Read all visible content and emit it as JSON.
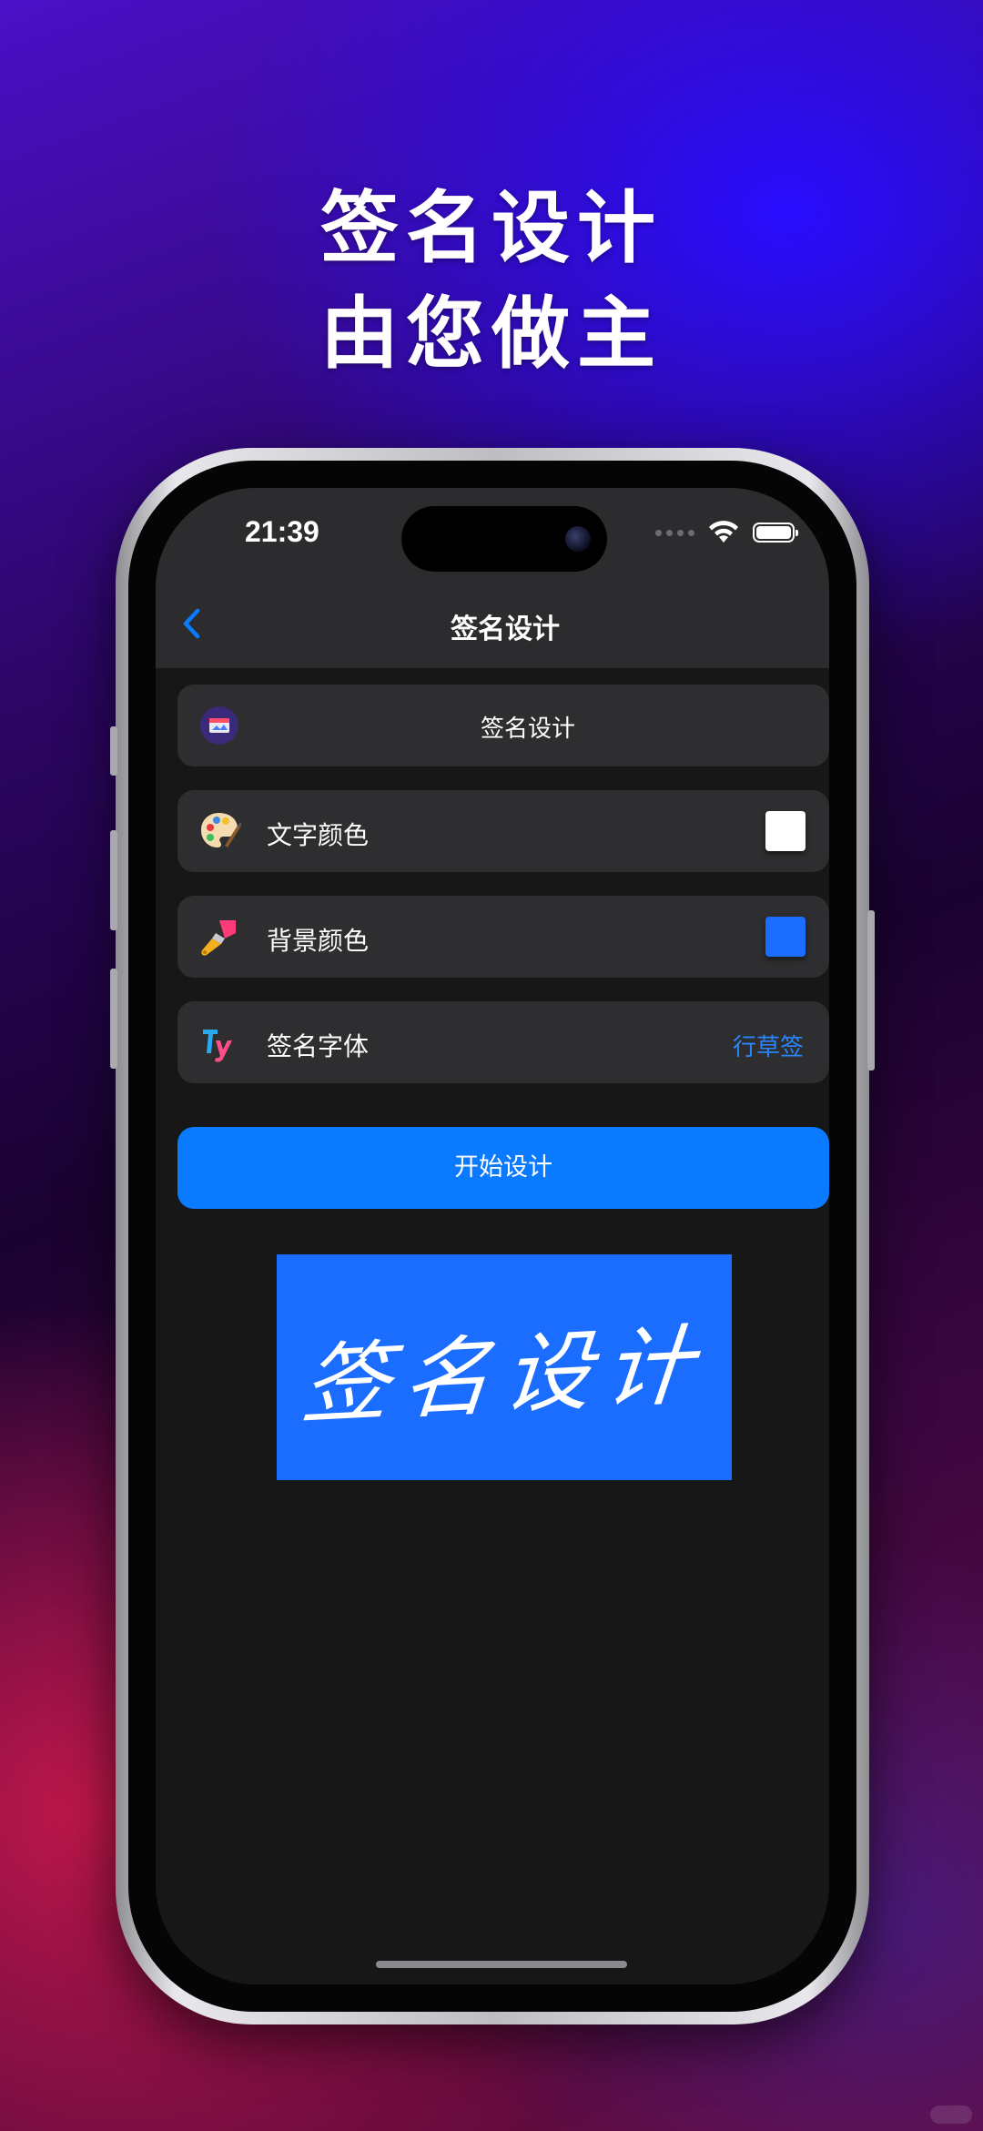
{
  "promo": {
    "line1": "签名设计",
    "line2": "由您做主"
  },
  "status_bar": {
    "time": "21:39",
    "wifi_icon": "wifi-icon",
    "battery_icon": "battery-icon"
  },
  "nav": {
    "back_icon": "chevron-left-icon",
    "title": "签名设计"
  },
  "form": {
    "input_row": {
      "icon": "signature-app-icon",
      "text": "签名设计"
    },
    "text_color": {
      "icon": "palette-icon",
      "label": "文字颜色",
      "color": "#ffffff"
    },
    "bg_color": {
      "icon": "paint-brush-icon",
      "label": "背景颜色",
      "color": "#1a6dff"
    },
    "font": {
      "icon": "font-icon",
      "label": "签名字体",
      "value": "行草签"
    },
    "start_button": "开始设计"
  },
  "preview": {
    "text": "签名设计",
    "background": "#1a6dff",
    "text_color": "#ffffff"
  },
  "colors": {
    "accent": "#0a7aff",
    "link": "#2a86ff"
  }
}
